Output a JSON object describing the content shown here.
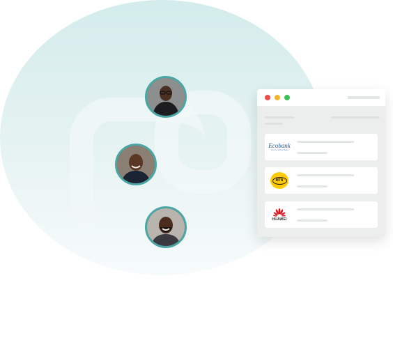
{
  "window": {
    "controls": {
      "close_color": "#ee4e4e",
      "minimize_color": "#f2b632",
      "maximize_color": "#3fc15a"
    }
  },
  "partners": [
    {
      "name": "Ecobank",
      "logo_icon": "ecobank-logo-icon",
      "logo_text": "Ecobank",
      "logo_subtext": "The Pan African Bank"
    },
    {
      "name": "MTN",
      "logo_icon": "mtn-logo-icon",
      "logo_text": "MTN"
    },
    {
      "name": "Huawei",
      "logo_icon": "huawei-logo-icon",
      "logo_text": "HUAWEI"
    }
  ],
  "avatars": [
    {
      "icon": "person-glasses-avatar"
    },
    {
      "icon": "person-smiling-avatar"
    },
    {
      "icon": "person-bearded-avatar"
    }
  ],
  "colors": {
    "accent": "#4aa7a5",
    "background_circle": "#d9eeee"
  }
}
